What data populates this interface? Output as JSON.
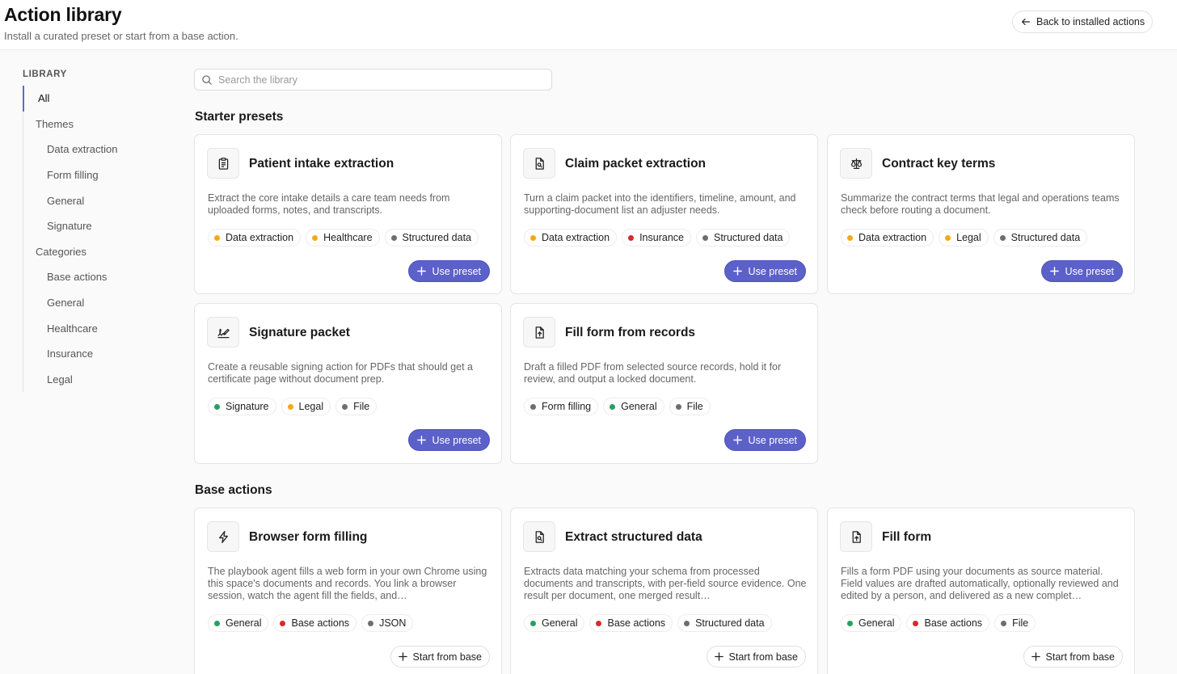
{
  "header": {
    "title": "Action library",
    "subtitle": "Install a curated preset or start from a base action.",
    "back_label": "Back to installed actions"
  },
  "sidebar": {
    "heading": "LIBRARY",
    "items": [
      {
        "label": "All",
        "level": 1,
        "active": true
      },
      {
        "label": "Themes",
        "level": 1
      },
      {
        "label": "Data extraction",
        "level": 2
      },
      {
        "label": "Form filling",
        "level": 2
      },
      {
        "label": "General",
        "level": 2
      },
      {
        "label": "Signature",
        "level": 2
      },
      {
        "label": "Categories",
        "level": 1
      },
      {
        "label": "Base actions",
        "level": 2
      },
      {
        "label": "General",
        "level": 2
      },
      {
        "label": "Healthcare",
        "level": 2
      },
      {
        "label": "Insurance",
        "level": 2
      },
      {
        "label": "Legal",
        "level": 2
      }
    ]
  },
  "search": {
    "placeholder": "Search the library",
    "value": ""
  },
  "colors": {
    "accent": "#5c61c9",
    "yellow": "#f5a915",
    "red": "#d52b2b",
    "green": "#27a062",
    "gray": "#6e6e6e"
  },
  "sections": {
    "presets_title": "Starter presets",
    "base_title": "Base actions"
  },
  "presets": [
    {
      "title": "Patient intake extraction",
      "icon": "clipboard-icon",
      "description": "Extract the core intake details a care team needs from uploaded forms, notes, and transcripts.",
      "tags": [
        {
          "label": "Data extraction",
          "color": "#f5a915"
        },
        {
          "label": "Healthcare",
          "color": "#f5a915"
        },
        {
          "label": "Structured data",
          "color": "#6e6e6e"
        }
      ],
      "button": "Use preset"
    },
    {
      "title": "Claim packet extraction",
      "icon": "document-search-icon",
      "description": "Turn a claim packet into the identifiers, timeline, amount, and supporting-document list an adjuster needs.",
      "tags": [
        {
          "label": "Data extraction",
          "color": "#f5a915"
        },
        {
          "label": "Insurance",
          "color": "#d52b2b"
        },
        {
          "label": "Structured data",
          "color": "#6e6e6e"
        }
      ],
      "button": "Use preset"
    },
    {
      "title": "Contract key terms",
      "icon": "scale-icon",
      "description": "Summarize the contract terms that legal and operations teams check before routing a document.",
      "tags": [
        {
          "label": "Data extraction",
          "color": "#f5a915"
        },
        {
          "label": "Legal",
          "color": "#f5a915"
        },
        {
          "label": "Structured data",
          "color": "#6e6e6e"
        }
      ],
      "button": "Use preset"
    },
    {
      "title": "Signature packet",
      "icon": "signature-icon",
      "description": "Create a reusable signing action for PDFs that should get a certificate page without document prep.",
      "tags": [
        {
          "label": "Signature",
          "color": "#27a062"
        },
        {
          "label": "Legal",
          "color": "#f5a915"
        },
        {
          "label": "File",
          "color": "#6e6e6e"
        }
      ],
      "button": "Use preset"
    },
    {
      "title": "Fill form from records",
      "icon": "document-upload-icon",
      "description": "Draft a filled PDF from selected source records, hold it for review, and output a locked document.",
      "tags": [
        {
          "label": "Form filling",
          "color": "#6e6e6e"
        },
        {
          "label": "General",
          "color": "#27a062"
        },
        {
          "label": "File",
          "color": "#6e6e6e"
        }
      ],
      "button": "Use preset"
    }
  ],
  "base_actions": [
    {
      "title": "Browser form filling",
      "icon": "lightning-icon",
      "description": "The playbook agent fills a web form in your own Chrome using this space's documents and records. You link a browser session, watch the agent fill the fields, and…",
      "tags": [
        {
          "label": "General",
          "color": "#27a062"
        },
        {
          "label": "Base actions",
          "color": "#d52b2b"
        },
        {
          "label": "JSON",
          "color": "#6e6e6e"
        }
      ],
      "button": "Start from base"
    },
    {
      "title": "Extract structured data",
      "icon": "document-search-icon",
      "description": "Extracts data matching your schema from processed documents and transcripts, with per-field source evidence. One result per document, one merged result…",
      "tags": [
        {
          "label": "General",
          "color": "#27a062"
        },
        {
          "label": "Base actions",
          "color": "#d52b2b"
        },
        {
          "label": "Structured data",
          "color": "#6e6e6e"
        }
      ],
      "button": "Start from base"
    },
    {
      "title": "Fill form",
      "icon": "document-upload-icon",
      "description": "Fills a form PDF using your documents as source material. Field values are drafted automatically, optionally reviewed and edited by a person, and delivered as a new complet…",
      "tags": [
        {
          "label": "General",
          "color": "#27a062"
        },
        {
          "label": "Base actions",
          "color": "#d52b2b"
        },
        {
          "label": "File",
          "color": "#6e6e6e"
        }
      ],
      "button": "Start from base"
    }
  ]
}
